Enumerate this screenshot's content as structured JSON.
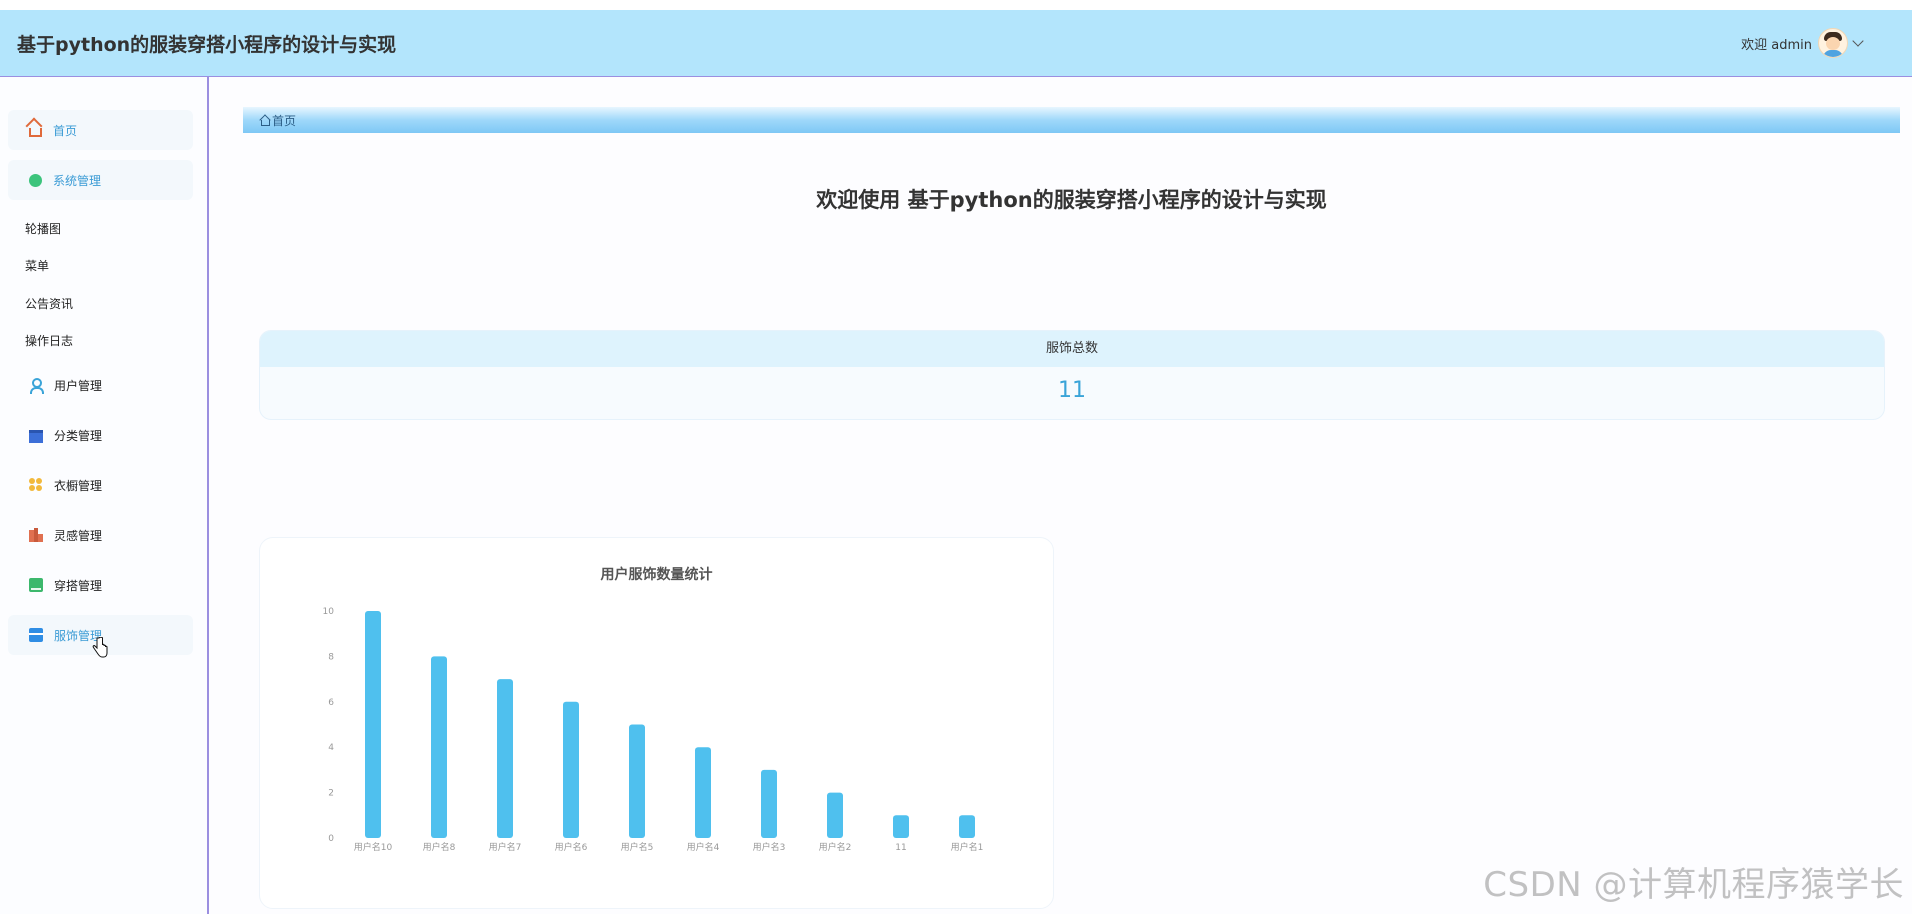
{
  "header": {
    "app_title": "基于python的服装穿搭小程序的设计与实现",
    "welcome_text": "欢迎 admin"
  },
  "sidebar": {
    "items": [
      {
        "label": "首页",
        "icon": "home-icon"
      },
      {
        "label": "系统管理",
        "icon": "system-icon"
      },
      {
        "label": "用户管理",
        "icon": "user-icon"
      },
      {
        "label": "分类管理",
        "icon": "category-icon"
      },
      {
        "label": "衣橱管理",
        "icon": "wardrobe-icon"
      },
      {
        "label": "灵感管理",
        "icon": "inspiration-icon"
      },
      {
        "label": "穿搭管理",
        "icon": "outfit-icon"
      },
      {
        "label": "服饰管理",
        "icon": "clothing-icon"
      }
    ],
    "subitems": [
      {
        "label": "轮播图"
      },
      {
        "label": "菜单"
      },
      {
        "label": "公告资讯"
      },
      {
        "label": "操作日志"
      }
    ],
    "active_item": "服饰管理"
  },
  "breadcrumb": {
    "label": "首页"
  },
  "main": {
    "welcome_title": "欢迎使用 基于python的服装穿搭小程序的设计与实现",
    "stat_card": {
      "label": "服饰总数",
      "value": "11"
    }
  },
  "chart_data": {
    "type": "bar",
    "title": "用户服饰数量统计",
    "categories": [
      "用户名10",
      "用户名8",
      "用户名7",
      "用户名6",
      "用户名5",
      "用户名4",
      "用户名3",
      "用户名2",
      "11",
      "用户名1"
    ],
    "values": [
      10,
      8,
      7,
      6,
      5,
      4,
      3,
      2,
      1,
      1
    ],
    "yticks": [
      0,
      2,
      4,
      6,
      8,
      10
    ],
    "ylim": [
      0,
      10
    ],
    "grid": false,
    "bar_color": "#4fc0ee"
  },
  "colors": {
    "header_bg": "#b3e5fc",
    "accent": "#3aa4d8",
    "sidebar_border": "#9b8fe0"
  },
  "watermark": "CSDN @计算机程序猿学长"
}
